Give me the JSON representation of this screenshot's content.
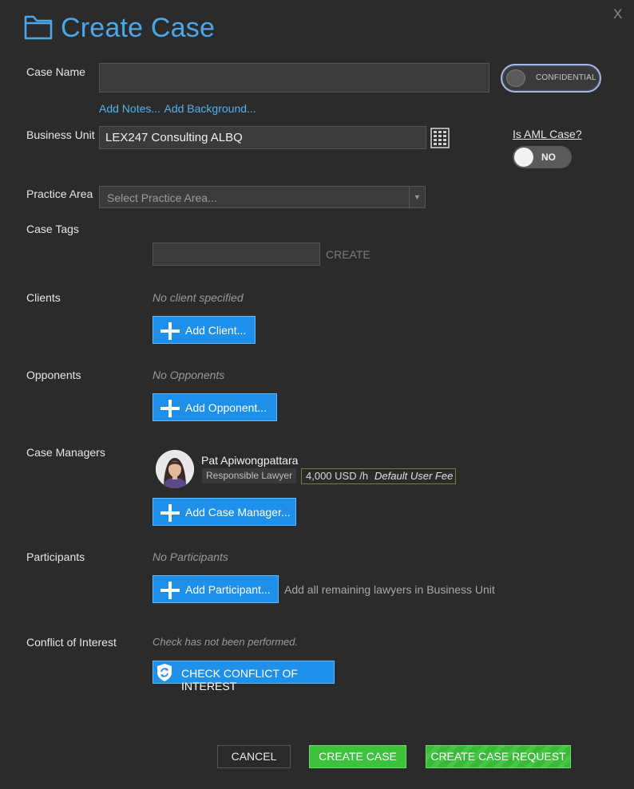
{
  "window": {
    "title": "Create Case",
    "close_label": "X"
  },
  "case_name": {
    "label": "Case Name",
    "value": "",
    "confidential_label": "CONFIDENTIAL",
    "add_notes": "Add Notes...",
    "add_background": "Add Background..."
  },
  "business_unit": {
    "label": "Business Unit",
    "value": "LEX247 Consulting ALBQ",
    "icon": "grid-icon"
  },
  "aml": {
    "label": "Is AML Case?",
    "value": "NO"
  },
  "practice_area": {
    "label": "Practice Area",
    "placeholder": "Select Practice Area..."
  },
  "case_tags": {
    "label": "Case Tags",
    "value": "",
    "create_label": "CREATE"
  },
  "clients": {
    "label": "Clients",
    "empty_text": "No client specified",
    "add_label": "Add Client..."
  },
  "opponents": {
    "label": "Opponents",
    "empty_text": "No Opponents",
    "add_label": "Add Opponent..."
  },
  "case_managers": {
    "label": "Case Managers",
    "items": [
      {
        "name": "Pat Apiwongpattara",
        "role": "Responsible Lawyer",
        "fee": "4,000 USD /h",
        "fee_note": "Default User Fee"
      }
    ],
    "add_label": "Add Case Manager..."
  },
  "participants": {
    "label": "Participants",
    "empty_text": "No Participants",
    "add_label": "Add Participant...",
    "add_all_label": "Add all remaining lawyers in Business Unit"
  },
  "conflict": {
    "label": "Conflict of Interest",
    "status_text": "Check has not been performed.",
    "check_label": "CHECK CONFLICT OF INTEREST"
  },
  "footer": {
    "cancel_label": "CANCEL",
    "create_label": "CREATE CASE",
    "request_label": "CREATE CASE REQUEST"
  },
  "colors": {
    "background": "#2b2b2b",
    "accent_blue": "#1e90ea",
    "title_blue": "#4ba8e8",
    "link_blue": "#55b1f0",
    "success_green": "#3cc23c"
  }
}
